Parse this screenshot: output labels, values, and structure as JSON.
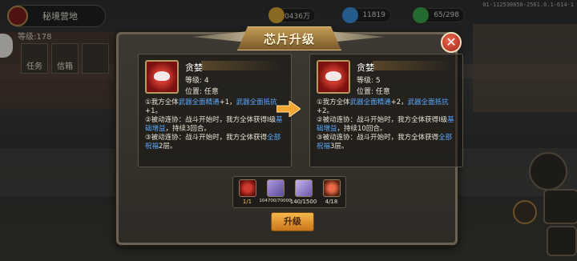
{
  "hud": {
    "player_name": "秘境营地",
    "level_text": "等级:178",
    "gold": "10436万",
    "gems": "11819",
    "stamina": "65/298",
    "server_text": "01-112530850-2561.0.1-614-1",
    "left_buttons": [
      "任务",
      "信箱",
      ""
    ]
  },
  "dialog": {
    "title": "芯片升级",
    "close_label": "✕",
    "current": {
      "name": "贪婪",
      "level": "等级: 4",
      "position": "位置: 任意",
      "desc1_a": "①我方全体",
      "desc1_b": "武器全面精通",
      "desc1_c": "+1，",
      "desc1_d": "武器全面抵抗",
      "desc1_e": "+1。",
      "desc2_a": "②被动连协：战斗开始时，我方全体获得I级",
      "desc2_b": "基础增益",
      "desc2_c": "，持续3回合。",
      "desc3_a": "③被动连协：战斗开始时，我方全体获得",
      "desc3_b": "全部祝福",
      "desc3_c": "2层。"
    },
    "next": {
      "name": "贪婪",
      "level": "等级: 5",
      "position": "位置: 任意",
      "desc1_a": "①我方全体",
      "desc1_b": "武器全面精通",
      "desc1_c": "+2，",
      "desc1_d": "武器全面抵抗",
      "desc1_e": "+2。",
      "desc2_a": "②被动连协：战斗开始时，我方全体获得I级",
      "desc2_b": "基础增益",
      "desc2_c": "，持续10回合。",
      "desc3_a": "③被动连协：战斗开始时，我方全体获得",
      "desc3_b": "全部祝福",
      "desc3_c": "3层。"
    },
    "materials": [
      {
        "count": "1/1"
      },
      {
        "count": "104700/70000"
      },
      {
        "count": "140/1500"
      },
      {
        "count": "4/18"
      }
    ],
    "upgrade_label": "升级"
  }
}
